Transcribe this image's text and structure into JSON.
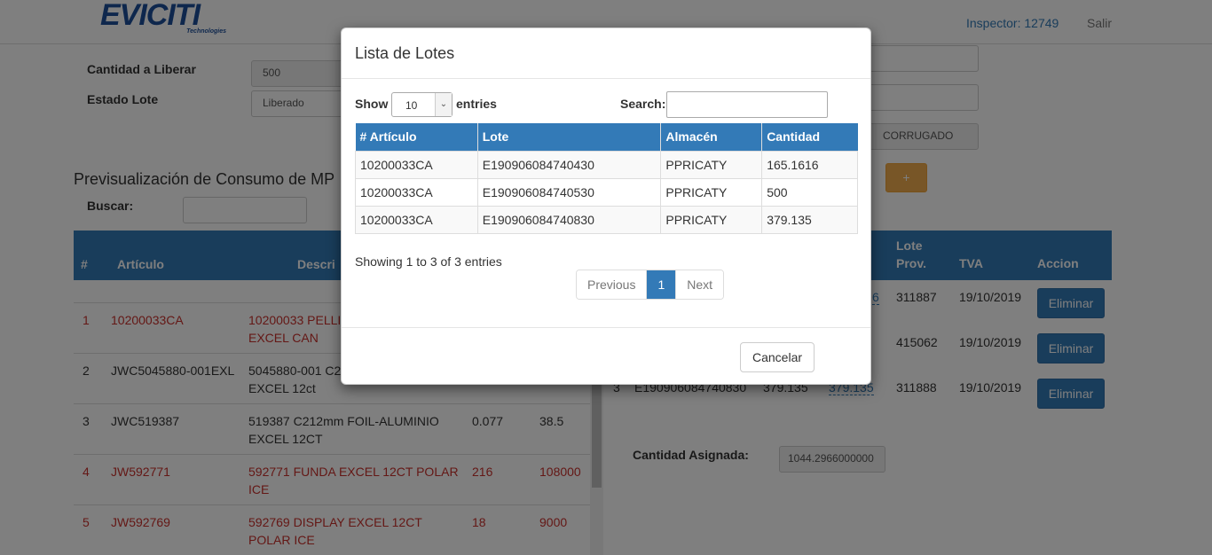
{
  "header": {
    "logo_text": "EVICITI",
    "logo_sub": "Technologies",
    "inspector": "Inspector: 12749",
    "logout": "Salir"
  },
  "form": {
    "cantidad_label": "Cantidad a Liberar",
    "cantidad_value": "500",
    "estado_label": "Estado Lote",
    "estado_value": "Liberado",
    "tipo_value": "CORRUGADO",
    "add_label": "+"
  },
  "preview": {
    "title": "Previsualización de Consumo de MP",
    "search_label": "Buscar:",
    "columns": {
      "num": "#",
      "articulo": "Artículo",
      "descripcion": "Descri",
      "lote_prov_1": "Lote",
      "lote_prov_2": "Prov.",
      "tva": "TVA",
      "accion": "Accion"
    },
    "rows": [
      {
        "num": "1",
        "articulo": "10200033CA",
        "desc1": "10200033 PELLI",
        "desc2": "EXCEL CAN",
        "c1": "",
        "c2": ""
      },
      {
        "num": "2",
        "articulo": "JWC5045880-001EXL",
        "desc1": "5045880-001 C2",
        "desc2": "EXCEL 12ct",
        "c1": "",
        "c2": ""
      },
      {
        "num": "3",
        "articulo": "JWC519387",
        "desc1": "519387 C212mm FOIL-ALUMINIO",
        "desc2": "EXCEL 12CT",
        "c1": "0.077",
        "c2": "38.5"
      },
      {
        "num": "4",
        "articulo": "JW592771",
        "desc1": "592771 FUNDA EXCEL 12CT POLAR",
        "desc2": "ICE",
        "c1": "216",
        "c2": "108000"
      },
      {
        "num": "5",
        "articulo": "JW592769",
        "desc1": "592769 DISPLAY EXCEL 12CT",
        "desc2": "POLAR ICE",
        "c1": "18",
        "c2": "9000"
      }
    ]
  },
  "assigned": {
    "rows": [
      {
        "num": "",
        "lote": "",
        "cant": "",
        "link": "6",
        "prov": "311887",
        "tva": "19/10/2019",
        "action": "Eliminar"
      },
      {
        "num": "",
        "lote": "",
        "cant": "",
        "link": "",
        "prov": "415062",
        "tva": "19/10/2019",
        "action": "Eliminar"
      },
      {
        "num": "3",
        "lote": "E190906084740830",
        "cant": "379.135",
        "link": "379.135",
        "prov": "311888",
        "tva": "19/10/2019",
        "action": "Eliminar"
      }
    ],
    "label": "Cantidad Asignada:",
    "value": "1044.2966000000"
  },
  "modal": {
    "title": "Lista de Lotes",
    "show_label": "Show",
    "entries_value": "10",
    "entries_label": "entries",
    "search_label": "Search:",
    "columns": [
      "# Artículo",
      "Lote",
      "Almacén",
      "Cantidad"
    ],
    "rows": [
      [
        "10200033CA",
        "E190906084740430",
        "PPRICATY",
        "165.1616"
      ],
      [
        "10200033CA",
        "E190906084740530",
        "PPRICATY",
        "500"
      ],
      [
        "10200033CA",
        "E190906084740830",
        "PPRICATY",
        "379.135"
      ]
    ],
    "info": "Showing 1 to 3 of 3 entries",
    "pager": {
      "previous": "Previous",
      "page": "1",
      "next": "Next"
    },
    "cancel": "Cancelar"
  }
}
